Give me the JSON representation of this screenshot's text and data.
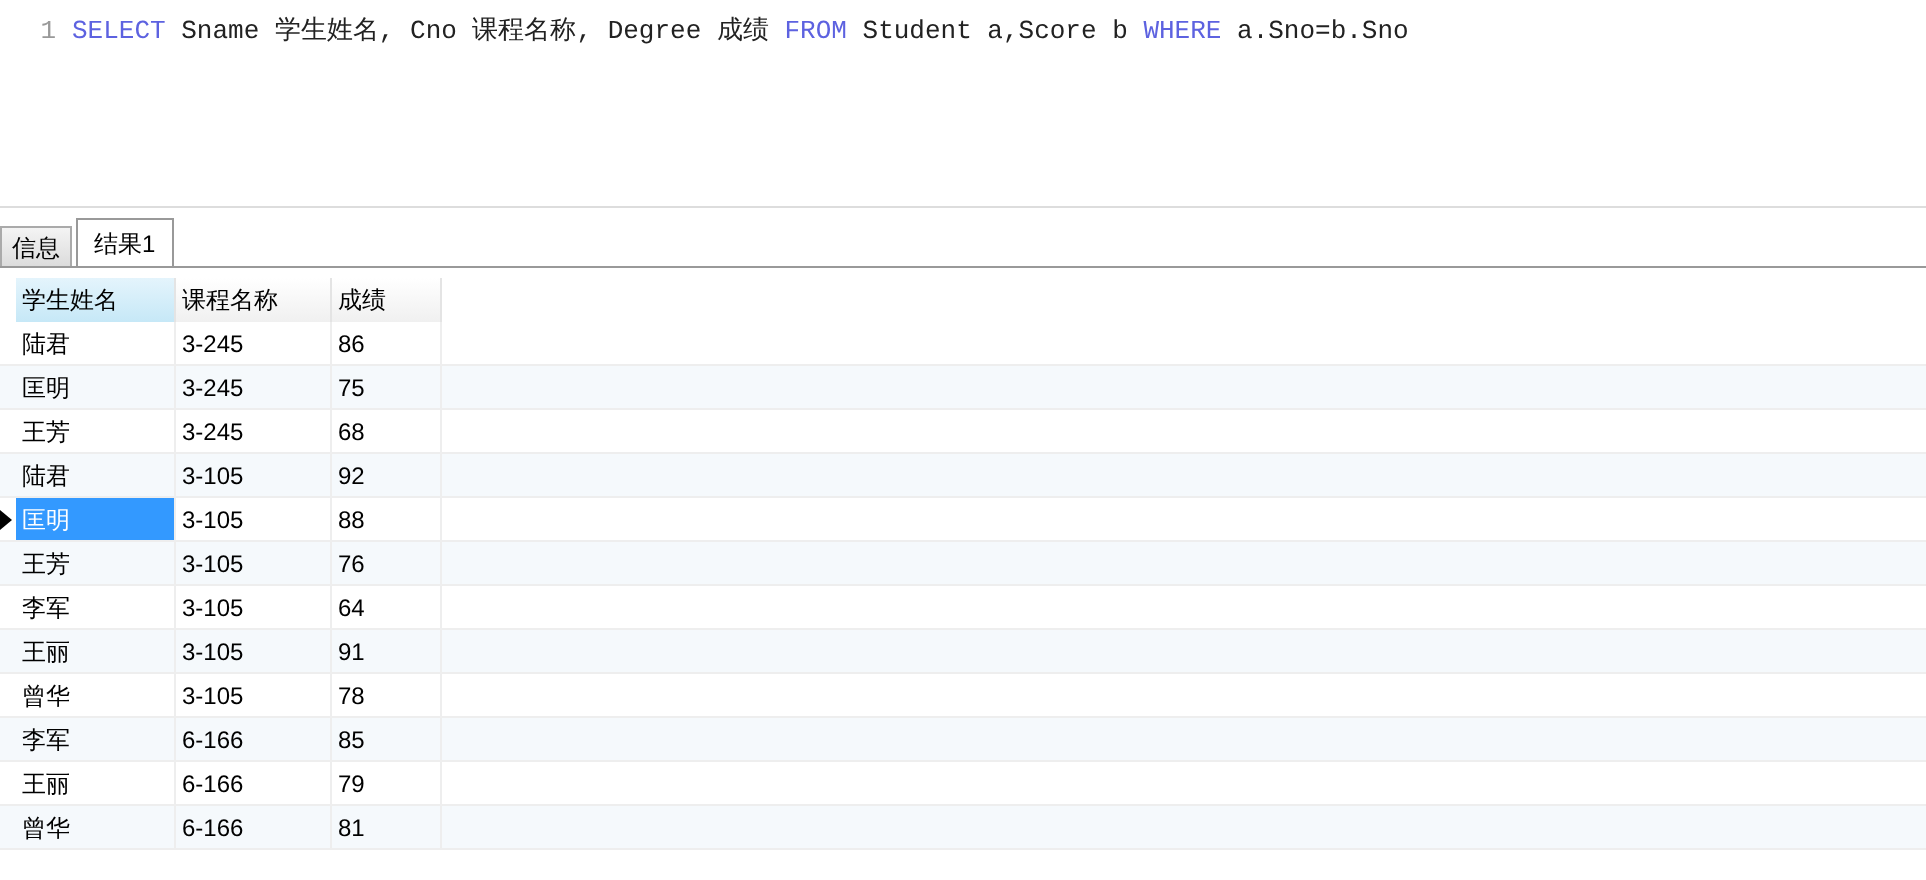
{
  "editor": {
    "lines": [
      {
        "number": "1",
        "tokens": [
          {
            "kind": "keyword",
            "text": "SELECT"
          },
          {
            "kind": "plain",
            "text": " Sname 学生姓名, Cno 课程名称, Degree 成绩 "
          },
          {
            "kind": "keyword",
            "text": "FROM"
          },
          {
            "kind": "plain",
            "text": " Student a,Score b "
          },
          {
            "kind": "keyword",
            "text": "WHERE"
          },
          {
            "kind": "plain",
            "text": " a.Sno=b.Sno"
          }
        ]
      }
    ]
  },
  "tabs": [
    {
      "label": "信息",
      "selected": false
    },
    {
      "label": "结果1",
      "selected": true
    }
  ],
  "table": {
    "columns": [
      "学生姓名",
      "课程名称",
      "成绩"
    ],
    "rows": [
      {
        "cells": [
          "陆君",
          "3-245",
          "86"
        ],
        "selected": false
      },
      {
        "cells": [
          "匡明",
          "3-245",
          "75"
        ],
        "selected": false
      },
      {
        "cells": [
          "王芳",
          "3-245",
          "68"
        ],
        "selected": false
      },
      {
        "cells": [
          "陆君",
          "3-105",
          "92"
        ],
        "selected": false
      },
      {
        "cells": [
          "匡明",
          "3-105",
          "88"
        ],
        "selected": true
      },
      {
        "cells": [
          "王芳",
          "3-105",
          "76"
        ],
        "selected": false
      },
      {
        "cells": [
          "李军",
          "3-105",
          "64"
        ],
        "selected": false
      },
      {
        "cells": [
          "王丽",
          "3-105",
          "91"
        ],
        "selected": false
      },
      {
        "cells": [
          "曾华",
          "3-105",
          "78"
        ],
        "selected": false
      },
      {
        "cells": [
          "李军",
          "6-166",
          "85"
        ],
        "selected": false
      },
      {
        "cells": [
          "王丽",
          "6-166",
          "79"
        ],
        "selected": false
      },
      {
        "cells": [
          "曾华",
          "6-166",
          "81"
        ],
        "selected": false
      }
    ]
  }
}
